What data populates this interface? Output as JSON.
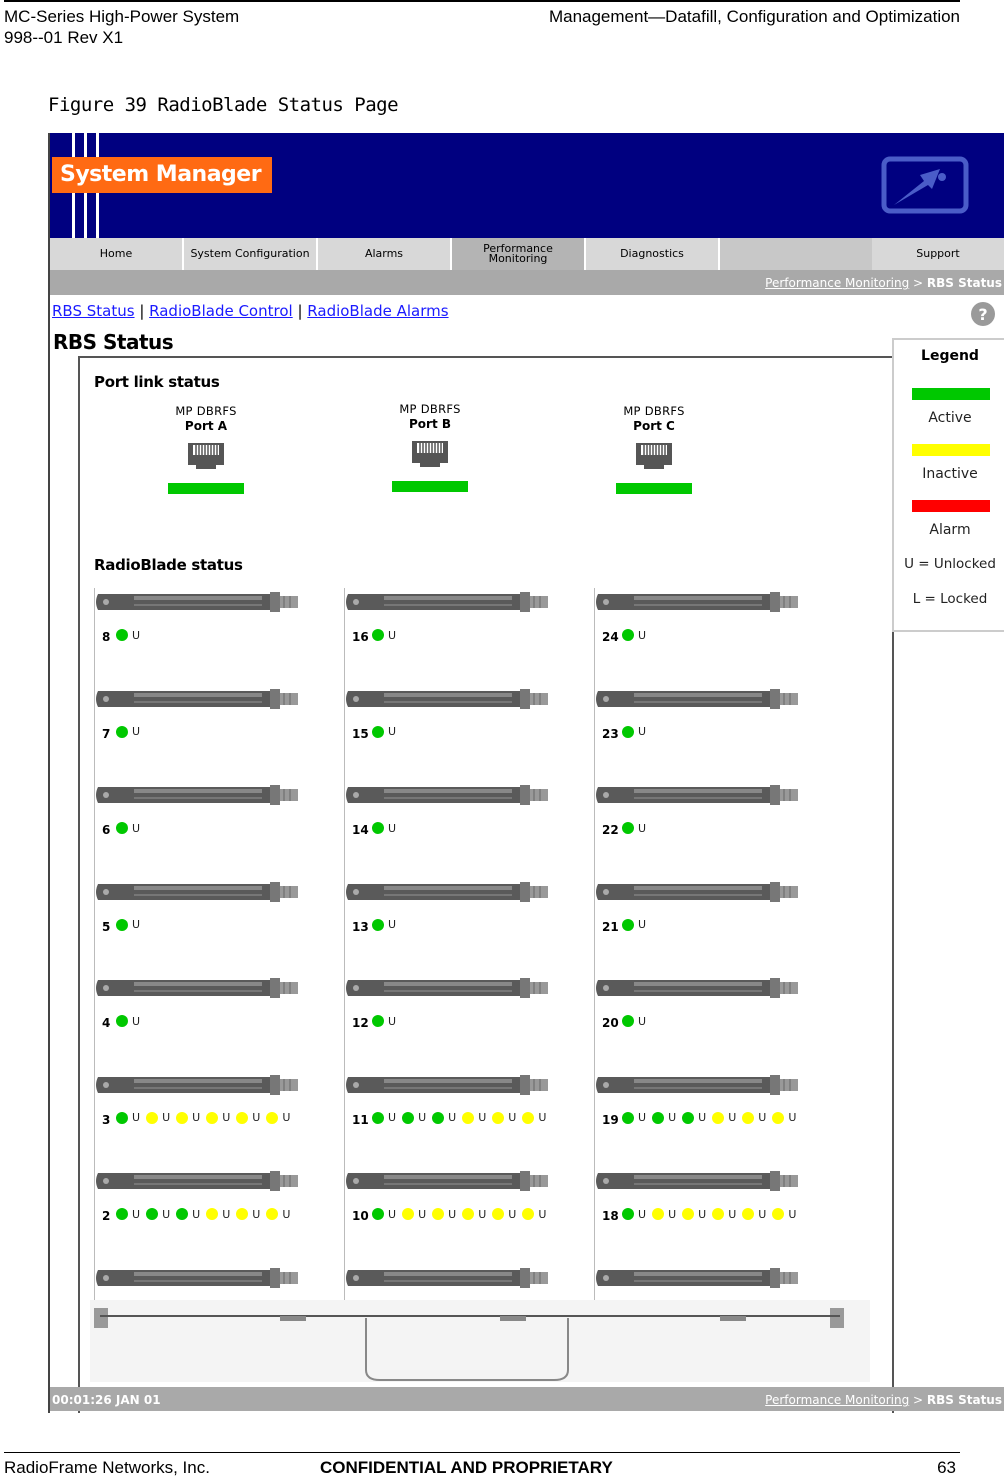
{
  "doc": {
    "header_left_1": "MC-Series High-Power System",
    "header_left_2": "998--01 Rev X1",
    "header_right": "Management—Datafill, Configuration and Optimization",
    "footer_left": "RadioFrame Networks, Inc.",
    "footer_center": "CONFIDENTIAL AND PROPRIETARY",
    "footer_page": "63",
    "figure_caption": "Figure 39  RadioBlade Status Page"
  },
  "app": {
    "logo_text": "System Manager",
    "nav_tabs": [
      {
        "label": "Home"
      },
      {
        "label": "System Configuration"
      },
      {
        "label": "Alarms"
      },
      {
        "label": "Performance Monitoring"
      },
      {
        "label": "Diagnostics"
      },
      {
        "label": "Support"
      }
    ],
    "breadcrumb": {
      "link": "Performance Monitoring",
      "sep": " > ",
      "current": "RBS Status"
    },
    "subnav": [
      {
        "label": "RBS Status"
      },
      {
        "label": "RadioBlade Control"
      },
      {
        "label": "RadioBlade Alarms"
      }
    ],
    "subnav_sep": " | ",
    "page_title": "RBS Status",
    "port_section_title": "Port link status",
    "ports": [
      {
        "device": "MP DBRFS",
        "port": "Port A",
        "state": "active"
      },
      {
        "device": "MP DBRFS",
        "port": "Port B",
        "state": "active"
      },
      {
        "device": "MP DBRFS",
        "port": "Port C",
        "state": "active"
      }
    ],
    "blade_section_title": "RadioBlade status",
    "blade_columns": [
      [
        {
          "num": "8",
          "states": [
            [
              "g",
              "U"
            ]
          ]
        },
        {
          "num": "7",
          "states": [
            [
              "g",
              "U"
            ]
          ]
        },
        {
          "num": "6",
          "states": [
            [
              "g",
              "U"
            ]
          ]
        },
        {
          "num": "5",
          "states": [
            [
              "g",
              "U"
            ]
          ]
        },
        {
          "num": "4",
          "states": [
            [
              "g",
              "U"
            ]
          ]
        },
        {
          "num": "3",
          "states": [
            [
              "g",
              "U"
            ],
            [
              "y",
              "U"
            ],
            [
              "y",
              "U"
            ],
            [
              "y",
              "U"
            ],
            [
              "y",
              "U"
            ],
            [
              "y",
              "U"
            ]
          ]
        },
        {
          "num": "2",
          "states": [
            [
              "g",
              "U"
            ],
            [
              "g",
              "U"
            ],
            [
              "g",
              "U"
            ],
            [
              "y",
              "U"
            ],
            [
              "y",
              "U"
            ],
            [
              "y",
              "U"
            ]
          ]
        },
        {
          "num": "",
          "states": []
        }
      ],
      [
        {
          "num": "16",
          "states": [
            [
              "g",
              "U"
            ]
          ]
        },
        {
          "num": "15",
          "states": [
            [
              "g",
              "U"
            ]
          ]
        },
        {
          "num": "14",
          "states": [
            [
              "g",
              "U"
            ]
          ]
        },
        {
          "num": "13",
          "states": [
            [
              "g",
              "U"
            ]
          ]
        },
        {
          "num": "12",
          "states": [
            [
              "g",
              "U"
            ]
          ]
        },
        {
          "num": "11",
          "states": [
            [
              "g",
              "U"
            ],
            [
              "g",
              "U"
            ],
            [
              "g",
              "U"
            ],
            [
              "y",
              "U"
            ],
            [
              "y",
              "U"
            ],
            [
              "y",
              "U"
            ]
          ]
        },
        {
          "num": "10",
          "states": [
            [
              "g",
              "U"
            ],
            [
              "y",
              "U"
            ],
            [
              "y",
              "U"
            ],
            [
              "y",
              "U"
            ],
            [
              "y",
              "U"
            ],
            [
              "y",
              "U"
            ]
          ]
        },
        {
          "num": "",
          "states": []
        }
      ],
      [
        {
          "num": "24",
          "states": [
            [
              "g",
              "U"
            ]
          ]
        },
        {
          "num": "23",
          "states": [
            [
              "g",
              "U"
            ]
          ]
        },
        {
          "num": "22",
          "states": [
            [
              "g",
              "U"
            ]
          ]
        },
        {
          "num": "21",
          "states": [
            [
              "g",
              "U"
            ]
          ]
        },
        {
          "num": "20",
          "states": [
            [
              "g",
              "U"
            ]
          ]
        },
        {
          "num": "19",
          "states": [
            [
              "g",
              "U"
            ],
            [
              "g",
              "U"
            ],
            [
              "g",
              "U"
            ],
            [
              "y",
              "U"
            ],
            [
              "y",
              "U"
            ],
            [
              "y",
              "U"
            ]
          ]
        },
        {
          "num": "18",
          "states": [
            [
              "g",
              "U"
            ],
            [
              "y",
              "U"
            ],
            [
              "y",
              "U"
            ],
            [
              "y",
              "U"
            ],
            [
              "y",
              "U"
            ],
            [
              "y",
              "U"
            ]
          ]
        },
        {
          "num": "",
          "states": []
        }
      ]
    ],
    "legend": {
      "title": "Legend",
      "items": [
        {
          "label": "Active",
          "color": "#00c800"
        },
        {
          "label": "Inactive",
          "color": "#ffff00"
        },
        {
          "label": "Alarm",
          "color": "#ff0000"
        }
      ],
      "key_unlocked": "U = Unlocked",
      "key_locked": "L = Locked"
    },
    "status_time": "00:01:26 JAN 01",
    "colors": {
      "green": "#00c800",
      "yellow": "#ffff00",
      "red": "#ff0000",
      "banner": "#000080",
      "logo": "#ff6a13",
      "link": "#1a1aff"
    },
    "icons": {
      "help": "help-icon",
      "brand": "brand-logo-icon",
      "port": "ethernet-port-icon",
      "blade": "radioblade-unit-icon"
    }
  }
}
